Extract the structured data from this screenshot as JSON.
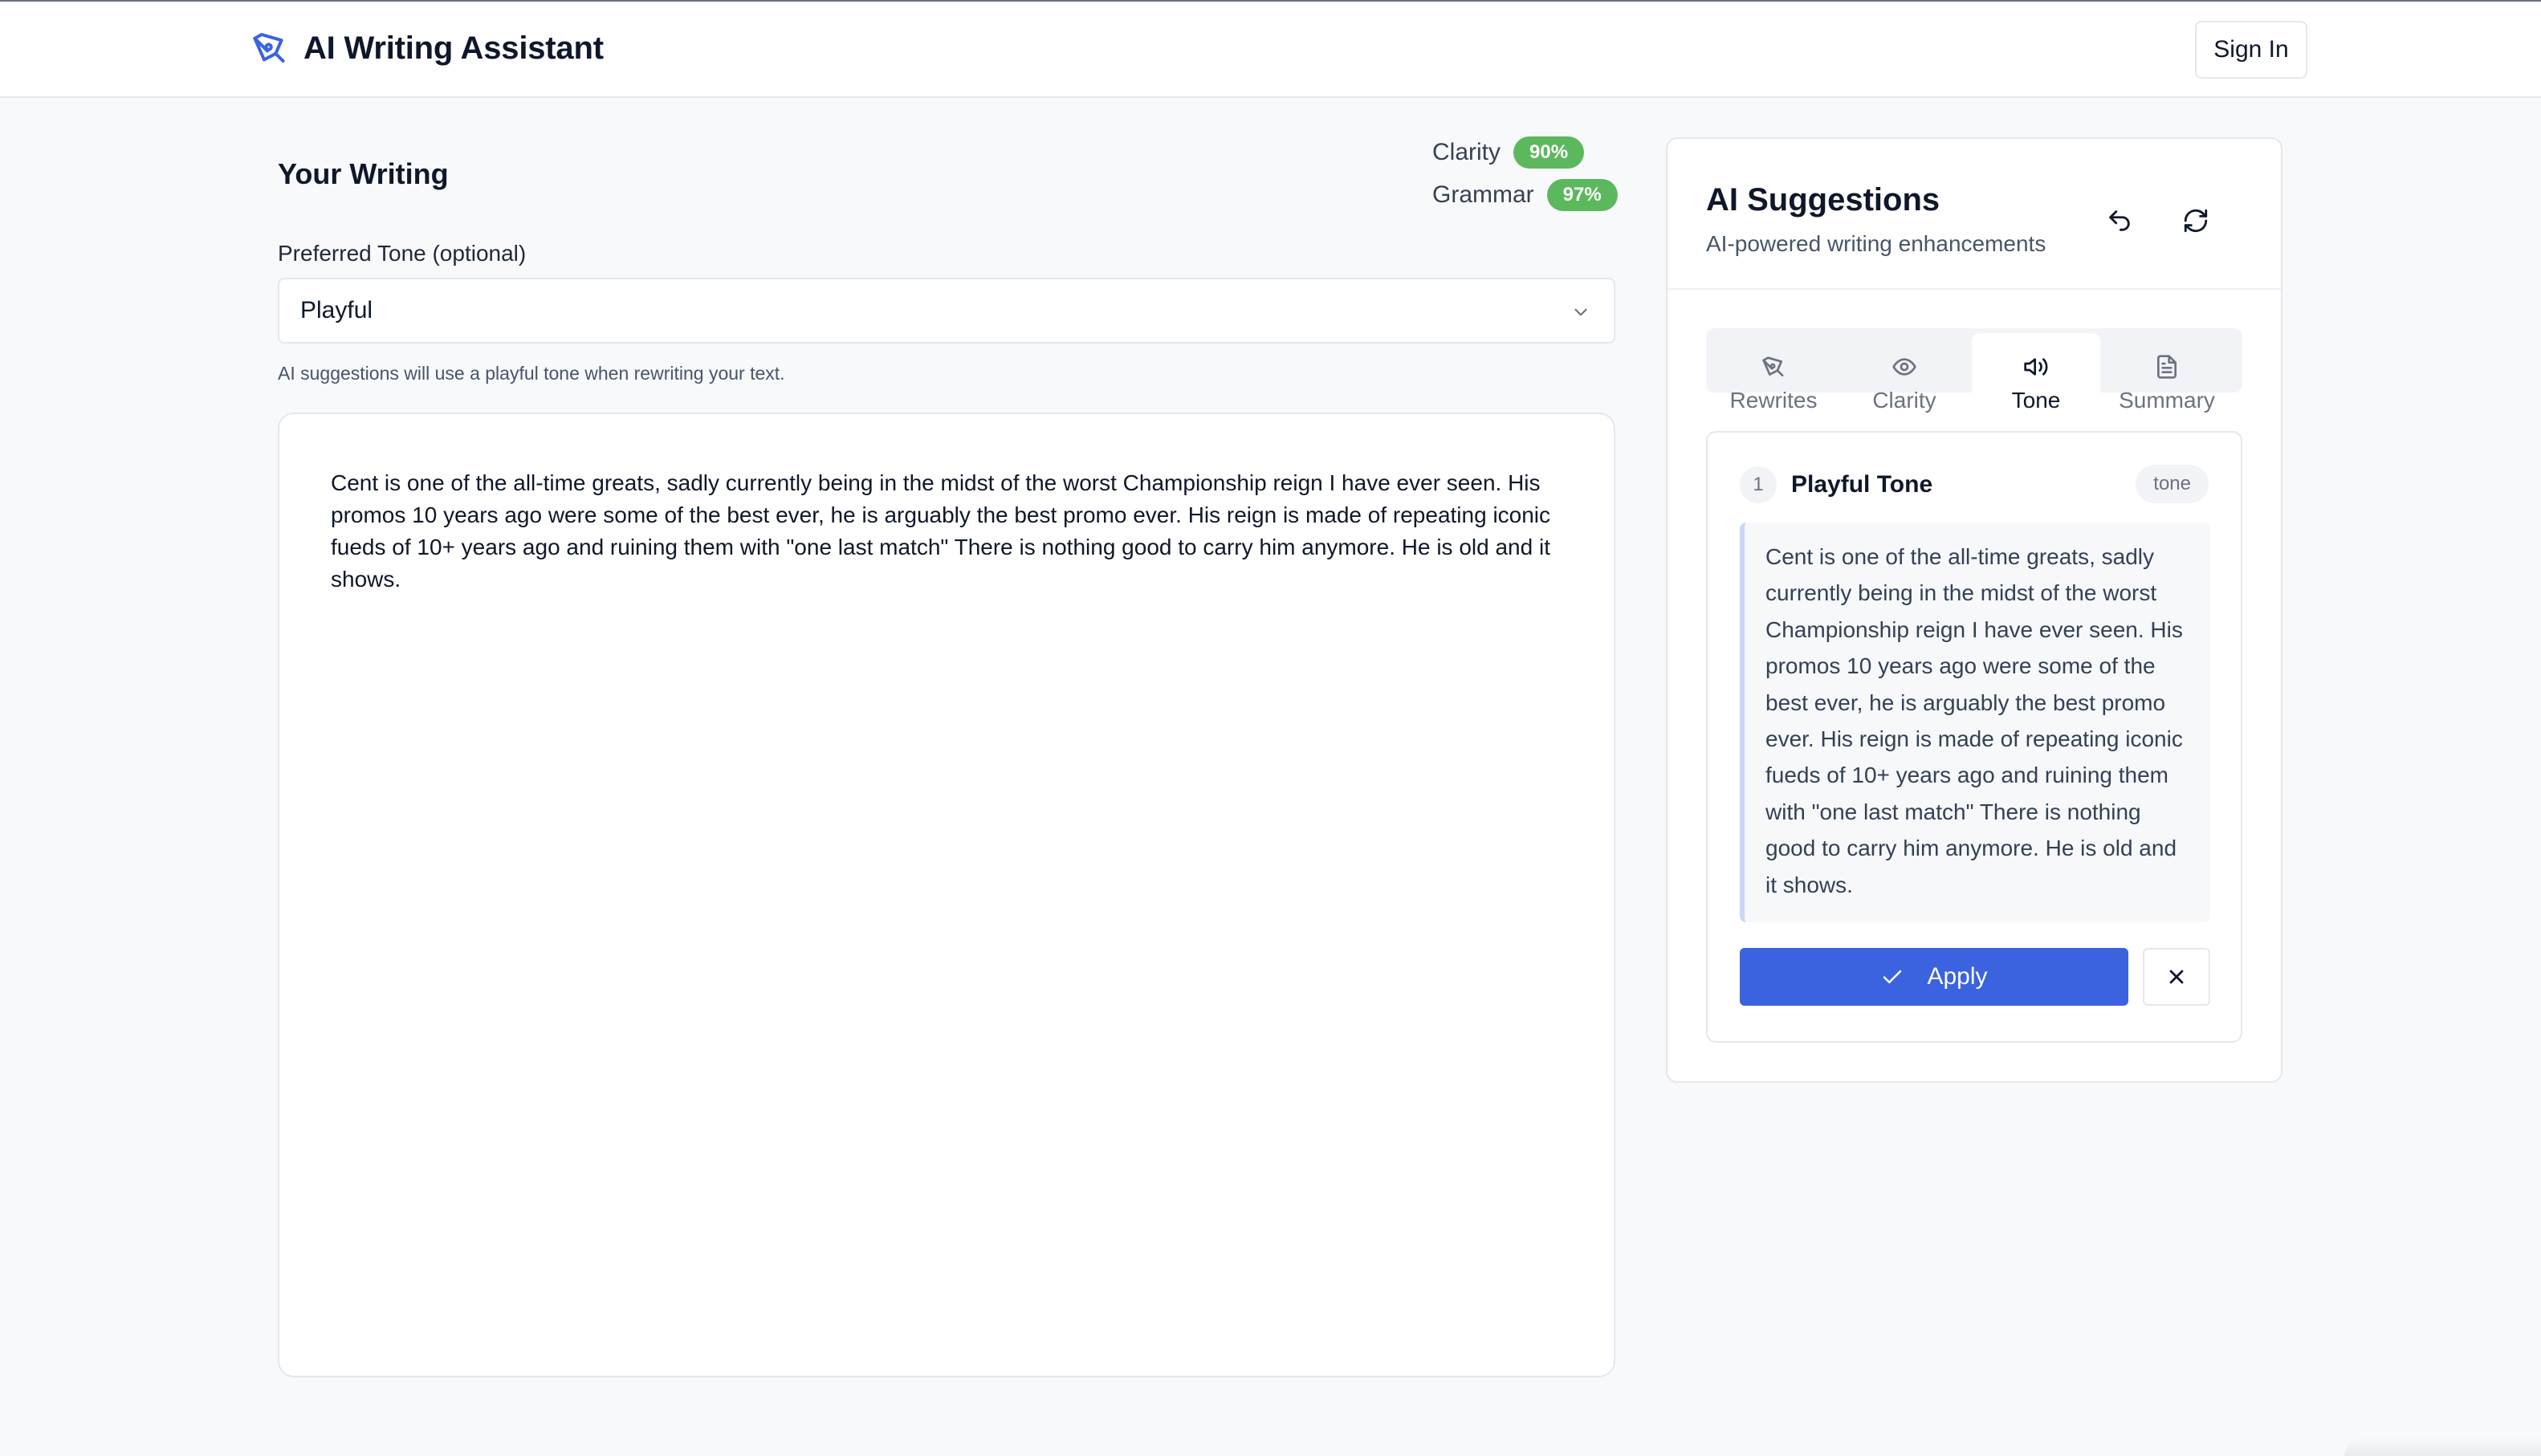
{
  "header": {
    "app_title": "AI Writing Assistant",
    "sign_in_label": "Sign In",
    "brand_icon": "pen-nib-icon"
  },
  "writing": {
    "title": "Your Writing",
    "metrics": [
      {
        "label": "Clarity",
        "value": "90%",
        "color": "#5cb85c"
      },
      {
        "label": "Grammar",
        "value": "97%",
        "color": "#5cb85c"
      }
    ],
    "tone_label": "Preferred Tone (optional)",
    "tone_value": "Playful",
    "tone_help": "AI suggestions will use a playful tone when rewriting your text.",
    "text": "Cent is one of the all-time greats, sadly currently being in the midst of the worst Championship reign I have ever seen. His promos 10 years ago were some of the best ever, he is arguably the best promo ever. His reign is made of repeating iconic fueds of 10+ years ago and ruining them with \"one last match\" There is nothing good to carry him anymore. He is old and it shows."
  },
  "suggestions": {
    "title": "AI Suggestions",
    "subtitle": "AI-powered writing enhancements",
    "undo_icon": "undo-icon",
    "refresh_icon": "refresh-icon",
    "tabs": [
      {
        "label": "Rewrites",
        "icon": "pen-nib-icon",
        "active": false
      },
      {
        "label": "Clarity",
        "icon": "eye-icon",
        "active": false
      },
      {
        "label": "Tone",
        "icon": "speaker-icon",
        "active": true
      },
      {
        "label": "Summary",
        "icon": "document-icon",
        "active": false
      }
    ],
    "card": {
      "number": "1",
      "title": "Playful Tone",
      "tag": "tone",
      "text": "Cent is one of the all-time greats, sadly currently being in the midst of the worst Championship reign I have ever seen. His promos 10 years ago were some of the best ever, he is arguably the best promo ever. His reign is made of repeating iconic fueds of 10+ years ago and ruining them with \"one last match\" There is nothing good to carry him anymore. He is old and it shows.",
      "apply_label": "Apply",
      "accent_color": "#3b63e0"
    }
  }
}
